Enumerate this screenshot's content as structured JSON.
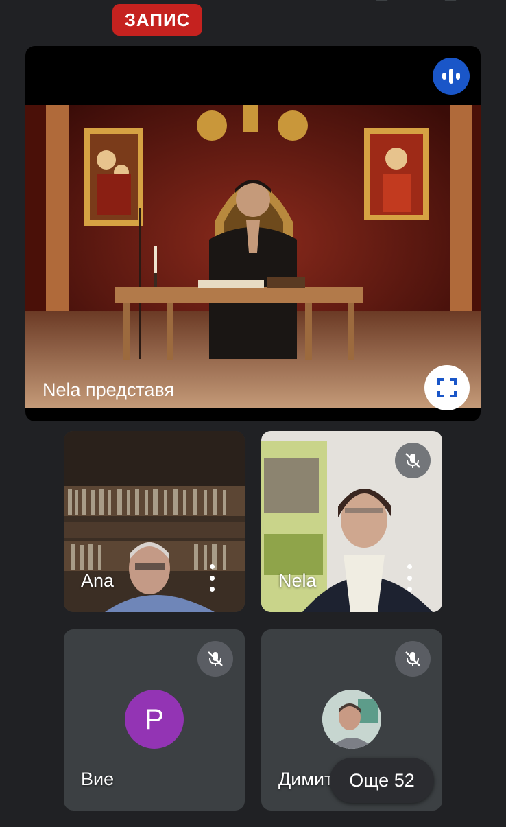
{
  "recording": {
    "label": "ЗАПИС",
    "color": "#c5221f"
  },
  "presentation": {
    "presenter_label": "Nela представя",
    "speaking_indicator_icon": "audio-bars-icon",
    "fullscreen_icon": "fullscreen-icon"
  },
  "participants": [
    {
      "name": "Ana",
      "muted": false,
      "video": true,
      "menu_icon": "more-vert-icon"
    },
    {
      "name": "Nela",
      "muted": true,
      "video": true,
      "menu_icon": "more-vert-icon",
      "mute_icon": "mic-off-icon"
    },
    {
      "name": "Вие",
      "muted": true,
      "video": false,
      "avatar_letter": "P",
      "avatar_color": "#9334b4",
      "mute_icon": "mic-off-icon"
    },
    {
      "name": "Димитър",
      "muted": true,
      "video": false,
      "avatar_type": "photo",
      "mute_icon": "mic-off-icon"
    }
  ],
  "more_participants": {
    "label": "Още 52"
  },
  "colors": {
    "background": "#202124",
    "tile": "#3c4043",
    "speaking": "#1a56c8"
  }
}
